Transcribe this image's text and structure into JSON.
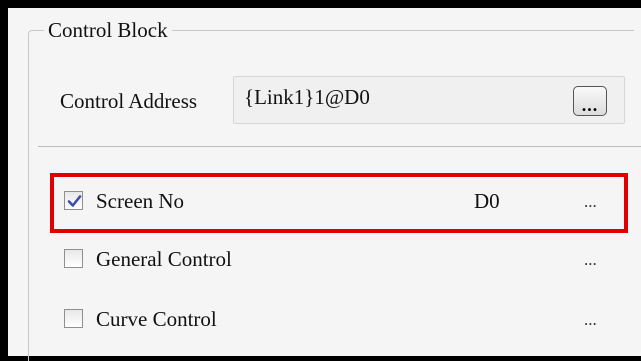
{
  "control_block": {
    "title": "Control Block",
    "address_label": "Control Address",
    "address_value": "{Link1}1@D0",
    "browse_label": "..."
  },
  "items": [
    {
      "label": "Screen No",
      "checked": true,
      "value": "D0",
      "more": "..."
    },
    {
      "label": "General Control",
      "checked": false,
      "value": "",
      "more": "..."
    },
    {
      "label": "Curve Control",
      "checked": false,
      "value": "",
      "more": "..."
    }
  ],
  "colors": {
    "highlight": "#e00000",
    "check_mark": "#3c4fa8"
  }
}
